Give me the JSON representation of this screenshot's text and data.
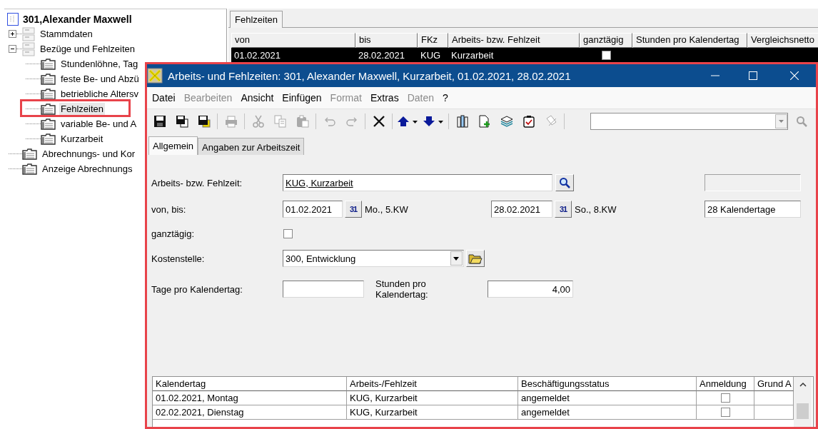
{
  "tree": {
    "root": {
      "label": "301,Alexander Maxwell",
      "children": [
        {
          "label": "Stammdaten",
          "kind": "group",
          "expanded": false,
          "selected": false,
          "highlighted": false
        },
        {
          "label": "Bezüge und Fehlzeiten",
          "kind": "group",
          "expanded": true,
          "selected": false,
          "highlighted": false,
          "children": [
            {
              "label": "Stundenlöhne, Tag",
              "kind": "page",
              "selected": false,
              "highlighted": false
            },
            {
              "label": "feste Be- und Abzü",
              "kind": "page",
              "selected": false,
              "highlighted": false
            },
            {
              "label": "betriebliche Altersv",
              "kind": "page",
              "selected": false,
              "highlighted": false
            },
            {
              "label": "Fehlzeiten",
              "kind": "page",
              "selected": true,
              "highlighted": true
            },
            {
              "label": "variable Be- und A",
              "kind": "page",
              "selected": false,
              "highlighted": false
            },
            {
              "label": "Kurzarbeit",
              "kind": "page",
              "selected": false,
              "highlighted": false
            }
          ]
        },
        {
          "label": "Abrechnungs- und Kor",
          "kind": "page",
          "selected": false,
          "highlighted": false
        },
        {
          "label": "Anzeige Abrechnungs",
          "kind": "page",
          "selected": false,
          "highlighted": false
        }
      ]
    }
  },
  "list": {
    "tabs": [
      {
        "label": "Fehlzeiten",
        "selected": true
      }
    ],
    "columns": [
      "von",
      "bis",
      "FKz",
      "Arbeits- bzw. Fehlzeit",
      "ganztägig",
      "Stunden pro Kalendertag",
      "Vergleichsnetto"
    ],
    "rows": [
      {
        "cells": [
          "01.02.2021",
          "28.02.2021",
          "KUG",
          "Kurzarbeit"
        ],
        "all_day": false,
        "selected": true
      }
    ]
  },
  "window": {
    "title": "Arbeits- und Fehlzeiten: 301, Alexander Maxwell, Kurzarbeit, 01.02.2021, 28.02.2021",
    "menu": [
      {
        "label": "Datei",
        "disabled": false
      },
      {
        "label": "Bearbeiten",
        "disabled": true
      },
      {
        "label": "Ansicht",
        "disabled": false
      },
      {
        "label": "Einfügen",
        "disabled": false
      },
      {
        "label": "Format",
        "disabled": true
      },
      {
        "label": "Extras",
        "disabled": false
      },
      {
        "label": "Daten",
        "disabled": true
      },
      {
        "label": "?",
        "disabled": false
      }
    ],
    "toolbar": [
      [
        {
          "kind": "save",
          "disabled": false
        },
        {
          "kind": "save_as",
          "disabled": false
        },
        {
          "kind": "save_all",
          "disabled": false
        }
      ],
      [
        {
          "kind": "print",
          "disabled": true
        }
      ],
      [
        {
          "kind": "cut",
          "disabled": true
        },
        {
          "kind": "copy",
          "disabled": true
        },
        {
          "kind": "paste",
          "disabled": true
        }
      ],
      [
        {
          "kind": "undo",
          "disabled": true
        },
        {
          "kind": "redo",
          "disabled": true
        }
      ],
      [
        {
          "kind": "delete",
          "disabled": false
        }
      ],
      [
        {
          "kind": "move_up",
          "disabled": false
        },
        {
          "kind": "move_down",
          "disabled": false
        }
      ],
      [
        {
          "kind": "attach",
          "disabled": false
        },
        {
          "kind": "new",
          "disabled": false
        },
        {
          "kind": "stack",
          "disabled": false
        },
        {
          "kind": "check",
          "disabled": false
        },
        {
          "kind": "edit",
          "disabled": true
        }
      ]
    ],
    "toolbar_search": {
      "disabled": true
    },
    "tabs": [
      {
        "label": "Allgemein",
        "selected": true
      },
      {
        "label": "Angaben zur Arbeitszeit",
        "selected": false
      }
    ],
    "form": {
      "activity": {
        "label": "Arbeits- bzw. Fehlzeit:",
        "value": "KUG, Kurzarbeit"
      },
      "period": {
        "label": "von, bis:",
        "from": "01.02.2021",
        "from_calendar": "31",
        "from_week": "Mo., 5.KW",
        "to": "28.02.2021",
        "to_calendar": "31",
        "to_week": "So., 8.KW",
        "days": "28 Kalendertage"
      },
      "all_day": {
        "label": "ganztägig:",
        "checked": false
      },
      "cost_center": {
        "label": "Kostenstelle:",
        "value": "300, Entwicklung"
      },
      "days_per_calendar_day": {
        "label": "Tage pro Kalendertag:"
      },
      "hours_per_calendar_day": {
        "label": "Stunden pro Kalendertag:",
        "value": "4,00"
      }
    },
    "grid": {
      "columns": [
        "Kalendertag",
        "Arbeits-/Fehlzeit",
        "Beschäftigungsstatus",
        "Anmeldung",
        "Grund A"
      ],
      "rows": [
        {
          "cells": [
            "01.02.2021, Montag",
            "KUG, Kurzarbeit",
            "angemeldet"
          ],
          "registered": false
        },
        {
          "cells": [
            "02.02.2021, Dienstag",
            "KUG, Kurzarbeit",
            "angemeldet"
          ],
          "registered": false
        }
      ]
    }
  }
}
